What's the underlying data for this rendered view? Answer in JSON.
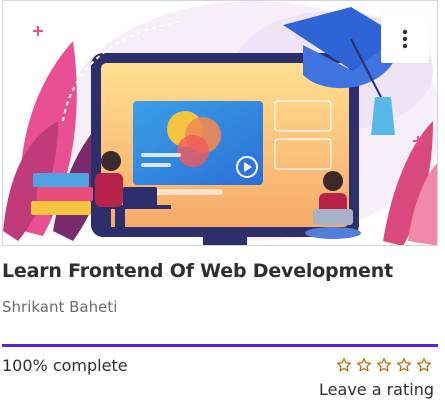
{
  "course": {
    "title": "Learn Frontend Of Web Development",
    "instructor": "Shrikant Baheti",
    "progress_text": "100% complete",
    "progress_fraction": 1.0,
    "rating_stars_total": 5,
    "rating_stars_filled": 0,
    "leave_rating_label": "Leave a rating"
  },
  "thumbnail": {
    "alt": "Course thumbnail illustration",
    "icon": "graduation-cap-laptop-illustration"
  },
  "menu": {
    "icon": "more-vertical-icon"
  },
  "colors": {
    "progress": "#5624d0",
    "star_outline": "#b4690e",
    "text_primary": "#2d2f31",
    "text_secondary": "#6a6f73"
  }
}
